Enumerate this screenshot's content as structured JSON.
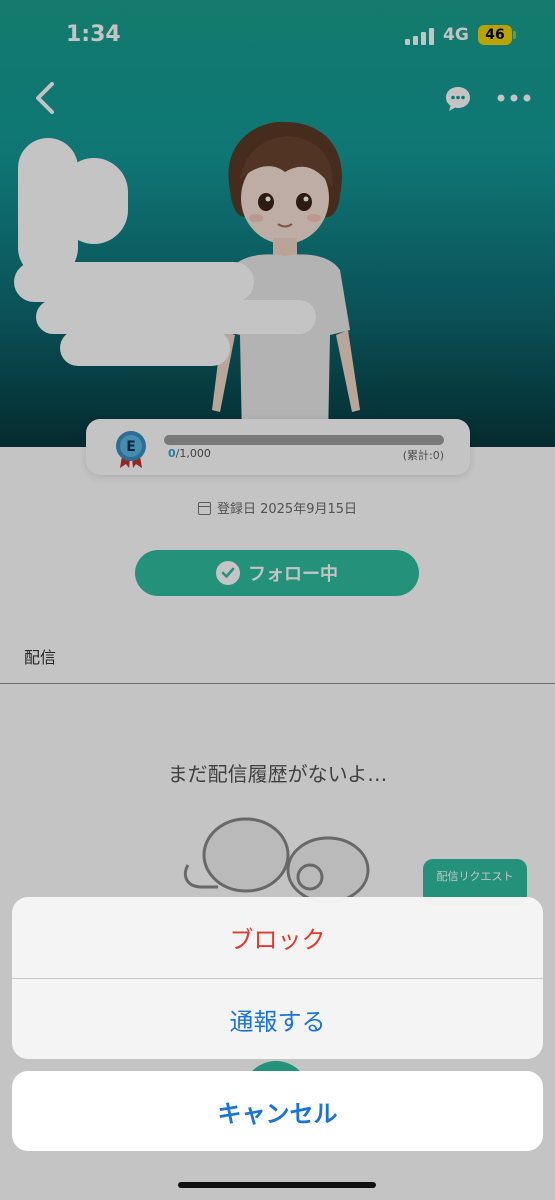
{
  "status_bar": {
    "time": "1:34",
    "network": "4G",
    "battery": "46"
  },
  "profile": {
    "level_badge": "E",
    "progress_current": "0",
    "progress_max": "/1,000",
    "progress_total": "(累計:0)",
    "progress_fraction": 0,
    "register_date": "登録日 2025年9月15日",
    "follow_label": "フォロー中",
    "section_label": "配信",
    "empty_text": "まだ配信履歴がないよ…",
    "request_label": "配信リクエスト"
  },
  "action_sheet": {
    "block_label": "ブロック",
    "report_label": "通報する",
    "cancel_label": "キャンセル"
  },
  "colors": {
    "accent": "#2fbf9f",
    "destructive": "#e23a2e",
    "action": "#1a73d9"
  }
}
